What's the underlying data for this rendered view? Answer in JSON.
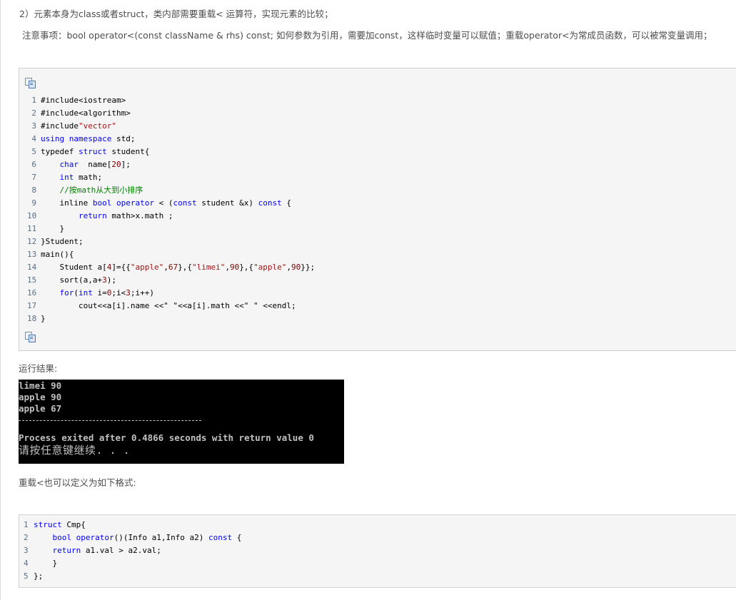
{
  "intro": {
    "line1": "2）元素本身为class或者struct，类内部需要重载< 运算符，实现元素的比较；",
    "note": "注意事项：bool operator<(const className & rhs) const; 如何参数为引用，需要加const，这样临时变量可以赋值；重载operator<为常成员函数，可以被常变量调用；"
  },
  "copy_icon": "copy-code-icon",
  "code_block_1": [
    {
      "n": "1",
      "tokens": [
        {
          "t": "#include<iostream>",
          "c": ""
        }
      ]
    },
    {
      "n": "2",
      "tokens": [
        {
          "t": "#include<algorithm>",
          "c": ""
        }
      ]
    },
    {
      "n": "3",
      "tokens": [
        {
          "t": "#include",
          "c": ""
        },
        {
          "t": "\"vector\"",
          "c": "str"
        }
      ]
    },
    {
      "n": "4",
      "tokens": [
        {
          "t": "using namespace",
          "c": "kw"
        },
        {
          "t": " std;",
          "c": ""
        }
      ]
    },
    {
      "n": "5",
      "tokens": [
        {
          "t": "typedef ",
          "c": ""
        },
        {
          "t": "struct",
          "c": "kw"
        },
        {
          "t": " student{",
          "c": ""
        }
      ]
    },
    {
      "n": "6",
      "tokens": [
        {
          "t": "    ",
          "c": ""
        },
        {
          "t": "char",
          "c": "kw"
        },
        {
          "t": "  name[",
          "c": ""
        },
        {
          "t": "20",
          "c": "num"
        },
        {
          "t": "];",
          "c": ""
        }
      ]
    },
    {
      "n": "7",
      "tokens": [
        {
          "t": "    ",
          "c": ""
        },
        {
          "t": "int",
          "c": "kw"
        },
        {
          "t": " math;",
          "c": ""
        }
      ]
    },
    {
      "n": "8",
      "tokens": [
        {
          "t": "    ",
          "c": ""
        },
        {
          "t": "//按math从大到小排序",
          "c": "cm"
        }
      ]
    },
    {
      "n": "9",
      "tokens": [
        {
          "t": "    inline ",
          "c": ""
        },
        {
          "t": "bool operator",
          "c": "kw"
        },
        {
          "t": " < (",
          "c": ""
        },
        {
          "t": "const",
          "c": "kw"
        },
        {
          "t": " student &x) ",
          "c": ""
        },
        {
          "t": "const",
          "c": "kw"
        },
        {
          "t": " {",
          "c": ""
        }
      ]
    },
    {
      "n": "10",
      "tokens": [
        {
          "t": "        ",
          "c": ""
        },
        {
          "t": "return",
          "c": "kw"
        },
        {
          "t": " math>x.math ;",
          "c": ""
        }
      ]
    },
    {
      "n": "11",
      "tokens": [
        {
          "t": "    }",
          "c": ""
        }
      ]
    },
    {
      "n": "12",
      "tokens": [
        {
          "t": "}Student;",
          "c": ""
        }
      ]
    },
    {
      "n": "13",
      "tokens": [
        {
          "t": "main(){",
          "c": ""
        }
      ]
    },
    {
      "n": "14",
      "tokens": [
        {
          "t": "    Student a[",
          "c": ""
        },
        {
          "t": "4",
          "c": "num"
        },
        {
          "t": "]={{",
          "c": ""
        },
        {
          "t": "\"apple\"",
          "c": "str"
        },
        {
          "t": ",",
          "c": ""
        },
        {
          "t": "67",
          "c": "num"
        },
        {
          "t": "},{",
          "c": ""
        },
        {
          "t": "\"limei\"",
          "c": "str"
        },
        {
          "t": ",",
          "c": ""
        },
        {
          "t": "90",
          "c": "num"
        },
        {
          "t": "},{",
          "c": ""
        },
        {
          "t": "\"apple\"",
          "c": "str"
        },
        {
          "t": ",",
          "c": ""
        },
        {
          "t": "90",
          "c": "num"
        },
        {
          "t": "}};",
          "c": ""
        }
      ]
    },
    {
      "n": "15",
      "tokens": [
        {
          "t": "    sort(a,a+",
          "c": ""
        },
        {
          "t": "3",
          "c": "num"
        },
        {
          "t": ");",
          "c": ""
        }
      ]
    },
    {
      "n": "16",
      "tokens": [
        {
          "t": "    ",
          "c": ""
        },
        {
          "t": "for",
          "c": "kw"
        },
        {
          "t": "(",
          "c": ""
        },
        {
          "t": "int",
          "c": "kw"
        },
        {
          "t": " i=",
          "c": ""
        },
        {
          "t": "0",
          "c": "num"
        },
        {
          "t": ";i<",
          "c": ""
        },
        {
          "t": "3",
          "c": "num"
        },
        {
          "t": ";i++)",
          "c": ""
        }
      ]
    },
    {
      "n": "17",
      "tokens": [
        {
          "t": "        cout<<a[i].name <<",
          "c": ""
        },
        {
          "t": "\" \"",
          "c": ""
        },
        {
          "t": "<<a[i].math <<",
          "c": ""
        },
        {
          "t": "\" \"",
          "c": ""
        },
        {
          "t": " <<endl;",
          "c": ""
        }
      ]
    },
    {
      "n": "18",
      "tokens": [
        {
          "t": "}",
          "c": ""
        }
      ]
    }
  ],
  "result_label": "运行结果:",
  "console": {
    "output_lines": [
      "limei 90",
      "apple 90",
      "apple 67"
    ],
    "separator": "--------------------------------",
    "process_line": "Process exited after 0.4866 seconds with return value 0",
    "prompt": "请按任意键继续. . ."
  },
  "overload_label": "重载<也可以定义为如下格式:",
  "code_block_2": [
    {
      "n": "1",
      "tokens": [
        {
          "t": "struct",
          "c": "kw"
        },
        {
          "t": " Cmp{",
          "c": ""
        }
      ]
    },
    {
      "n": "2",
      "tokens": [
        {
          "t": "    ",
          "c": ""
        },
        {
          "t": "bool operator",
          "c": "kw"
        },
        {
          "t": "()(Info a1,Info a2) ",
          "c": ""
        },
        {
          "t": "const",
          "c": "kw"
        },
        {
          "t": " {",
          "c": ""
        }
      ]
    },
    {
      "n": "3",
      "tokens": [
        {
          "t": "    ",
          "c": ""
        },
        {
          "t": "return",
          "c": "kw"
        },
        {
          "t": " a1.val > a2.val;",
          "c": ""
        }
      ]
    },
    {
      "n": "4",
      "tokens": [
        {
          "t": "    }",
          "c": ""
        }
      ]
    },
    {
      "n": "5",
      "tokens": [
        {
          "t": "};",
          "c": ""
        }
      ]
    }
  ]
}
